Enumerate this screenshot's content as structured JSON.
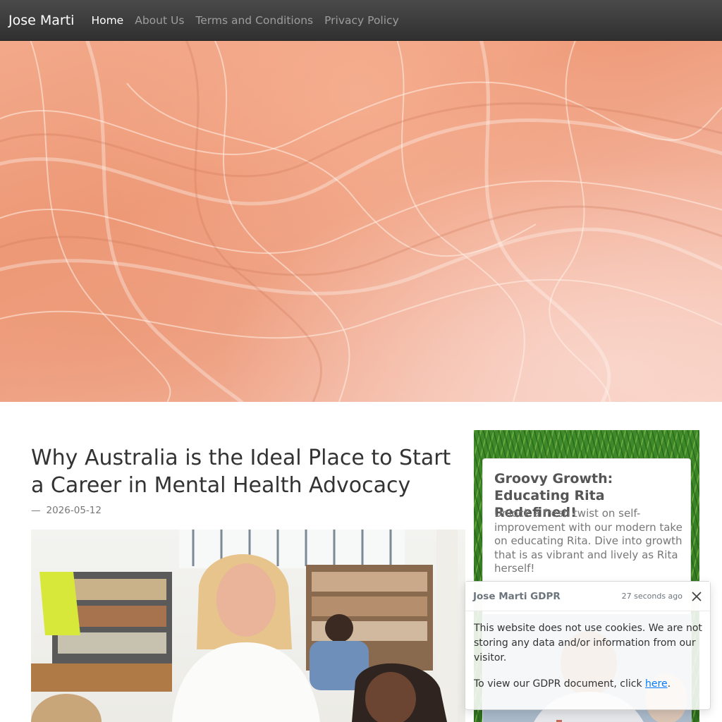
{
  "nav": {
    "brand": "Jose Marti",
    "links": [
      "Home",
      "About Us",
      "Terms and Conditions",
      "Privacy Policy"
    ],
    "active": "Home"
  },
  "article": {
    "title": "Why Australia is the Ideal Place to Start a Career in Mental Health Advocacy",
    "dash": "—",
    "date": "2026-05-12"
  },
  "sidebar": {
    "title": "Groovy Growth: Educating Rita Redefined!",
    "text": "Unlock a fresh twist on self-improvement with our modern take on educating Rita. Dive into growth that is as vibrant and lively as Rita herself!"
  },
  "toast": {
    "title": "Jose Marti GDPR",
    "time": "27 seconds ago",
    "message": "This website does not use cookies. We are not storing any data and/or information from our visitor.",
    "gdpr_prefix": "To view our GDPR document, click ",
    "gdpr_link": "here",
    "gdpr_suffix": "."
  },
  "icons": {
    "close": "close-icon"
  },
  "colors": {
    "navbar": "#3a3a3a",
    "nav_active": "#ffffff",
    "nav_inactive": "#9d9d9d",
    "hero": "#f2a98a",
    "link": "#007bff"
  }
}
